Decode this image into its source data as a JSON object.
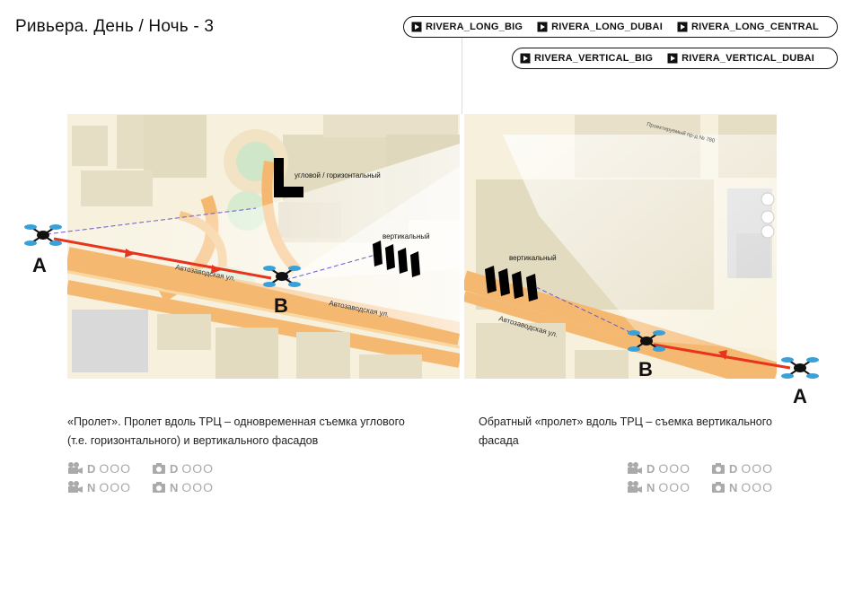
{
  "title": "Ривьера.  День / Ночь - 3",
  "pills": {
    "row1": [
      "RIVERA_LONG_BIG",
      "RIVERA_LONG_DUBAI",
      "RIVERA_LONG_CENTRAL"
    ],
    "row2": [
      "RIVERA_VERTICAL_BIG",
      "RIVERA_VERTICAL_DUBAI"
    ]
  },
  "map_left": {
    "label_angular": "угловой / горизонтальный",
    "label_vertical": "вертикальный",
    "street": "Автозаводская ул.",
    "street2": "Автозаводская ул.",
    "point_a": "A",
    "point_b": "B"
  },
  "map_right": {
    "label_vertical": "вертикальный",
    "street": "Автозаводская ул.",
    "road_label": "Проектируемый пр-д № 780",
    "point_a": "A",
    "point_b": "B"
  },
  "captions": {
    "left": [
      "«Пролет». Пролет вдоль ТРЦ – одновременная съемка углового",
      "(т.е. горизонтального) и вертикального фасадов"
    ],
    "right": "Обратный «пролет» вдоль ТРЦ – съемка вертикального фасада"
  },
  "stats": {
    "day": "D",
    "night": "N",
    "dots": "OOO"
  },
  "colors": {
    "flight_path": "#e8341c",
    "road": "#f5b870",
    "map_bg": "#f6f0dc",
    "building": "#e4dcc2"
  }
}
